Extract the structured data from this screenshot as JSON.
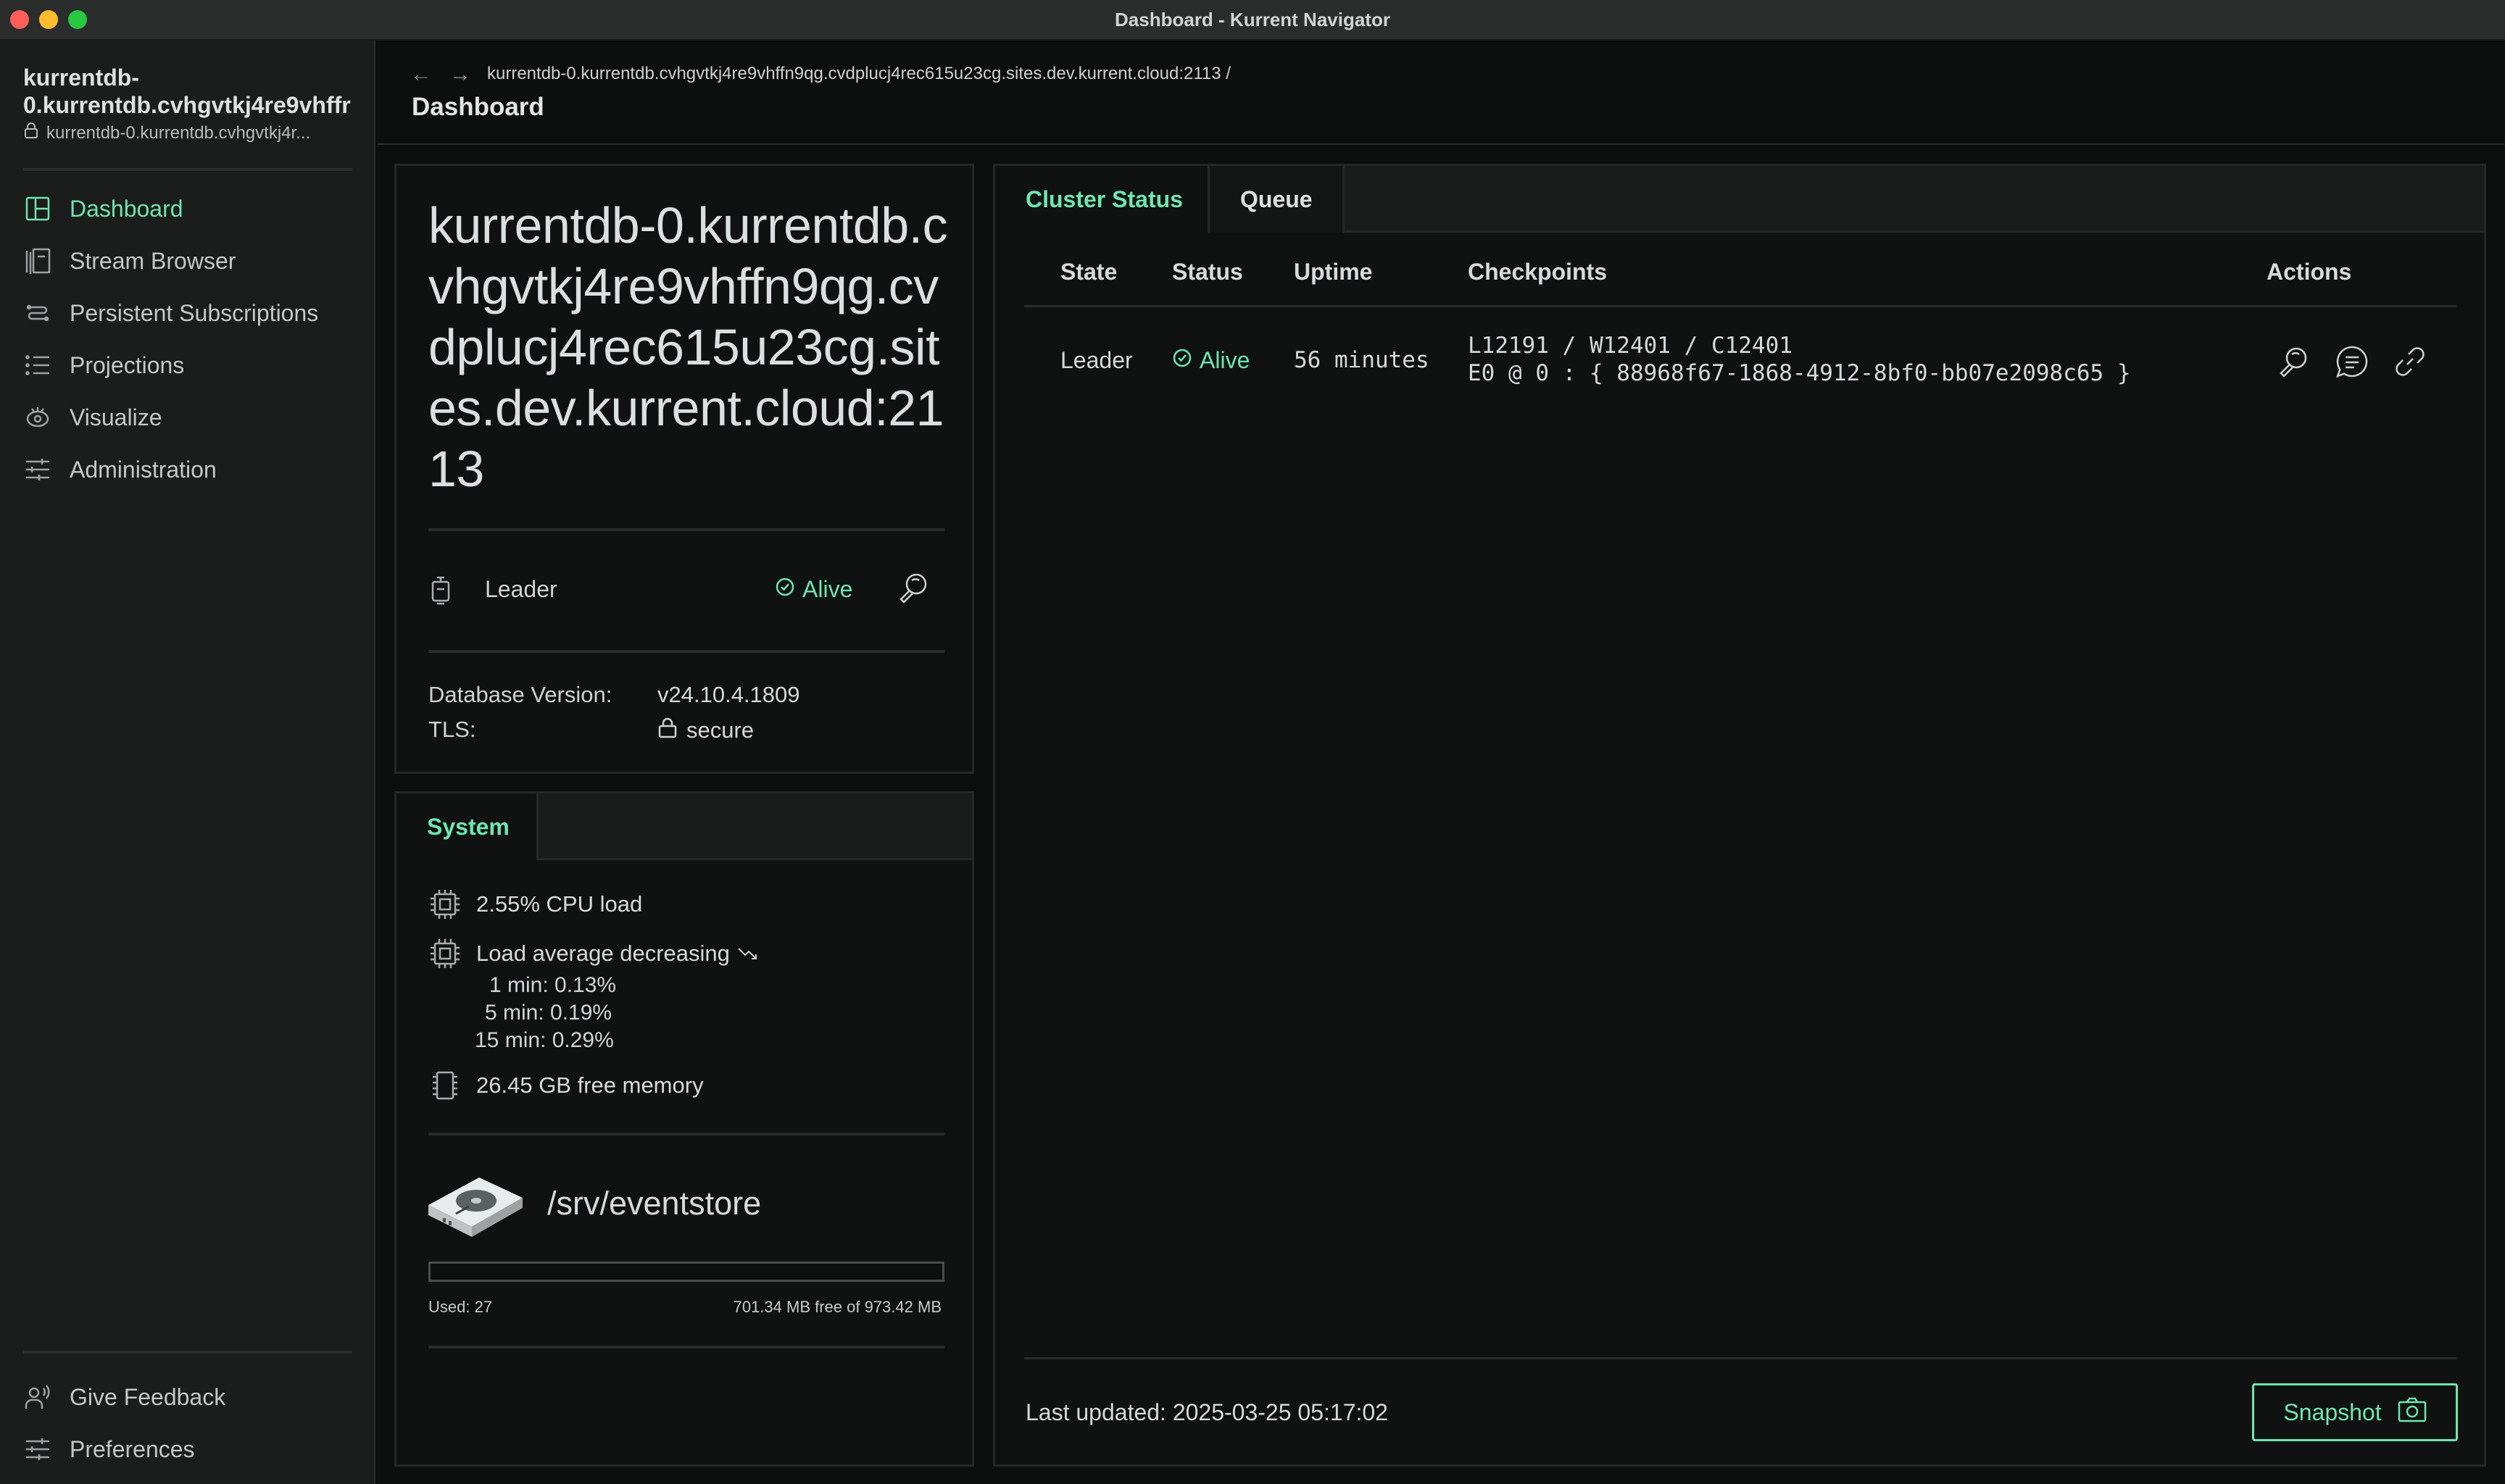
{
  "window": {
    "title": "Dashboard - Kurrent Navigator"
  },
  "sidebar": {
    "connection_name_line1": "kurrentdb-",
    "connection_name_line2": "0.kurrentdb.cvhgvtkj4re9vhffr",
    "connection_subtitle": "kurrentdb-0.kurrentdb.cvhgvtkj4r...",
    "items": [
      {
        "label": "Dashboard",
        "icon": "dashboard-icon",
        "active": true
      },
      {
        "label": "Stream Browser",
        "icon": "stream-browser-icon",
        "active": false
      },
      {
        "label": "Persistent Subscriptions",
        "icon": "subscriptions-icon",
        "active": false
      },
      {
        "label": "Projections",
        "icon": "projections-icon",
        "active": false
      },
      {
        "label": "Visualize",
        "icon": "visualize-icon",
        "active": false
      },
      {
        "label": "Administration",
        "icon": "administration-icon",
        "active": false
      }
    ],
    "bottom_items": [
      {
        "label": "Give Feedback",
        "icon": "feedback-icon"
      },
      {
        "label": "Preferences",
        "icon": "preferences-icon"
      }
    ]
  },
  "header": {
    "breadcrumb": "kurrentdb-0.kurrentdb.cvhgvtkj4re9vhffn9qg.cvdplucj4rec615u23cg.sites.dev.kurrent.cloud:2113 /",
    "title": "Dashboard"
  },
  "node": {
    "host": "kurrentdb-0.kurrentdb.cvhgvtkj4re9vhffn9qg.cvdplucj4rec615u23cg.sites.dev.kurrent.cloud:2113",
    "role": "Leader",
    "status": "Alive",
    "db_version_label": "Database Version:",
    "db_version": "v24.10.4.1809",
    "tls_label": "TLS:",
    "tls_value": "secure"
  },
  "system": {
    "tab_label": "System",
    "cpu_load": "2.55% CPU load",
    "load_average": "Load average decreasing",
    "load_1": "1 min: 0.13%",
    "load_5": "5 min: 0.19%",
    "load_15": "15 min: 0.29%",
    "free_memory": "26.45 GB free memory",
    "disk_path": "/srv/eventstore",
    "disk_used_label": "Used: 27",
    "disk_free_label": "701.34 MB free of 973.42 MB",
    "disk_used_fraction": 0.0
  },
  "cluster": {
    "tabs": [
      {
        "label": "Cluster Status",
        "active": true
      },
      {
        "label": "Queue",
        "active": false
      }
    ],
    "columns": [
      "State",
      "Status",
      "Uptime",
      "Checkpoints",
      "Actions"
    ],
    "rows": [
      {
        "state": "Leader",
        "status": "Alive",
        "uptime": "56 minutes",
        "checkpoint_line1": "L12191 / W12401 / C12401",
        "checkpoint_line2": "E0 @ 0 : { 88968f67-1868-4912-8bf0-bb07e2098c65 }"
      }
    ],
    "last_updated": "Last updated: 2025-03-25 05:17:02",
    "snapshot_label": "Snapshot"
  },
  "colors": {
    "accent": "#6ee6b0",
    "background": "#0d0e0e",
    "sidebar": "#1b1c1c"
  }
}
